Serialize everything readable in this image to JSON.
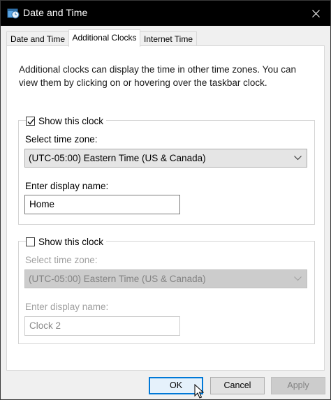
{
  "window": {
    "title": "Date and Time",
    "icon": "date-time-icon",
    "close_icon": "close-icon"
  },
  "tabs": [
    {
      "label": "Date and Time",
      "active": false
    },
    {
      "label": "Additional Clocks",
      "active": true
    },
    {
      "label": "Internet Time",
      "active": false
    }
  ],
  "description": "Additional clocks can display the time in other time zones. You can view them by clicking on or hovering over the taskbar clock.",
  "clock1": {
    "show_label": "Show this clock",
    "checked": true,
    "timezone_label": "Select time zone:",
    "timezone_value": "(UTC-05:00) Eastern Time (US & Canada)",
    "name_label": "Enter display name:",
    "name_value": "Home",
    "enabled": true
  },
  "clock2": {
    "show_label": "Show this clock",
    "checked": false,
    "timezone_label": "Select time zone:",
    "timezone_value": "(UTC-05:00) Eastern Time (US & Canada)",
    "name_label": "Enter display name:",
    "name_value": "Clock 2",
    "enabled": false
  },
  "buttons": {
    "ok": "OK",
    "cancel": "Cancel",
    "apply": "Apply"
  },
  "colors": {
    "titlebar": "#000000",
    "focus_accent": "#0078d7",
    "disabled_text": "#a0a0a0"
  }
}
